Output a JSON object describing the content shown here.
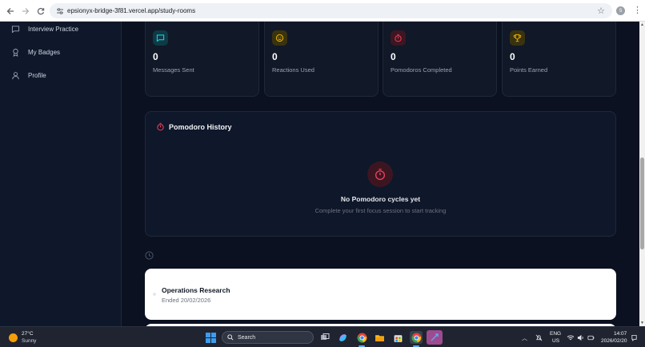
{
  "browser": {
    "url": "epsionyx-bridge-3f81.vercel.app/study-rooms",
    "profile_initial": "S"
  },
  "sidebar": {
    "items": [
      {
        "label": "Interview Practice",
        "icon": "chat-icon"
      },
      {
        "label": "My Badges",
        "icon": "badge-icon"
      },
      {
        "label": "Profile",
        "icon": "user-icon"
      }
    ]
  },
  "stats": [
    {
      "value": "0",
      "label": "Messages Sent",
      "icon": "message-icon",
      "color": "#22d3ee",
      "bg": "#0e3a45"
    },
    {
      "value": "0",
      "label": "Reactions Used",
      "icon": "smile-icon",
      "color": "#eab308",
      "bg": "#3a3310"
    },
    {
      "value": "0",
      "label": "Pomodoros Completed",
      "icon": "timer-icon",
      "color": "#f43f5e",
      "bg": "#3d1622"
    },
    {
      "value": "0",
      "label": "Points Earned",
      "icon": "trophy-icon",
      "color": "#eab308",
      "bg": "#3a3310"
    }
  ],
  "pomodoro_history": {
    "title": "Pomodoro History",
    "empty_title": "No Pomodoro cycles yet",
    "empty_subtitle": "Complete your first focus session to start tracking"
  },
  "rooms": [
    {
      "title": "Operations Research",
      "subtitle": "Ended 20/02/2026"
    }
  ],
  "taskbar": {
    "weather_temp": "27°C",
    "weather_desc": "Sunny",
    "search_placeholder": "Search",
    "lang_line1": "ENG",
    "lang_line2": "US",
    "time": "14:07",
    "date": "2026/02/20"
  }
}
